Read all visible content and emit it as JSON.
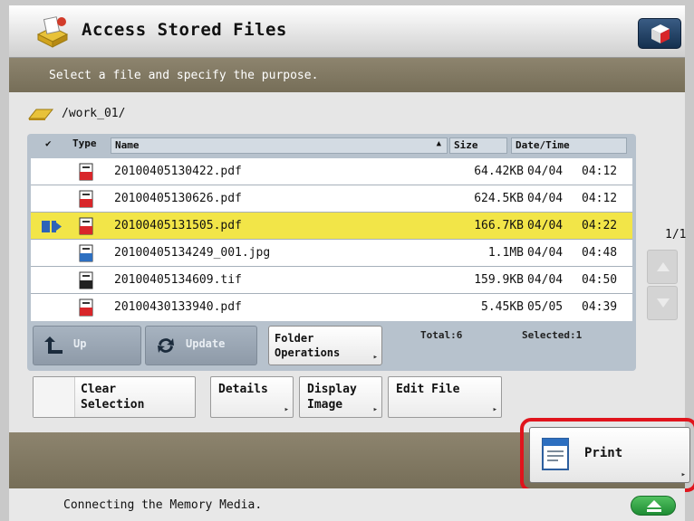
{
  "title": "Access Stored Files",
  "instruction": "Select a file and specify the purpose.",
  "current_path": "/work_01/",
  "columns": {
    "type": "Type",
    "name": "Name",
    "size": "Size",
    "date_time": "Date/Time"
  },
  "files": [
    {
      "name": "20100405130422.pdf",
      "size": "64.42KB",
      "date": "04/04",
      "time": "04:12",
      "type_icon": "pdf-file-icon",
      "selected": false
    },
    {
      "name": "20100405130626.pdf",
      "size": "624.5KB",
      "date": "04/04",
      "time": "04:12",
      "type_icon": "pdf-file-icon",
      "selected": false
    },
    {
      "name": "20100405131505.pdf",
      "size": "166.7KB",
      "date": "04/04",
      "time": "04:22",
      "type_icon": "pdf-file-icon",
      "selected": true
    },
    {
      "name": "20100405134249_001.jpg",
      "size": "1.1MB",
      "date": "04/04",
      "time": "04:48",
      "type_icon": "jpg-file-icon",
      "selected": false
    },
    {
      "name": "20100405134609.tif",
      "size": "159.9KB",
      "date": "04/04",
      "time": "04:50",
      "type_icon": "tif-file-icon",
      "selected": false
    },
    {
      "name": "20100430133940.pdf",
      "size": "5.45KB",
      "date": "05/05",
      "time": "04:39",
      "type_icon": "pdf-file-icon",
      "selected": false
    }
  ],
  "panel_buttons": {
    "up": "Up",
    "update": "Update",
    "folder_ops_1": "Folder",
    "folder_ops_2": "Operations"
  },
  "total": "Total:6",
  "selected": "Selected:1",
  "page": "1/1",
  "actions": {
    "clear_1": "Clear",
    "clear_2": "Selection",
    "details": "Details",
    "display_1": "Display",
    "display_2": "Image",
    "edit": "Edit File"
  },
  "print_label": "Print",
  "status_text": "Connecting the Memory Media.",
  "colors": {
    "selected_row": "#f2e548",
    "header_bar": "#7f7761",
    "highlight_ring": "#e0141c",
    "eject_button": "#2aa03e"
  }
}
